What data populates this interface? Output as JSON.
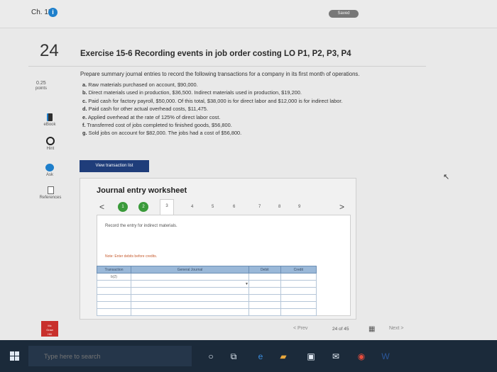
{
  "header": {
    "chapter": "Ch. 15",
    "saved_label": "Saved"
  },
  "question": {
    "number": "24",
    "title": "Exercise 15-6 Recording events in job order costing LO P1, P2, P3, P4",
    "points_value": "0.25",
    "points_label": "points",
    "prompt": "Prepare summary journal entries to record the following transactions for a company in its first month of operations.",
    "items": [
      {
        "letter": "a.",
        "text": "Raw materials purchased on account, $90,000."
      },
      {
        "letter": "b.",
        "text": "Direct materials used in production, $36,500. Indirect materials used in production, $19,200."
      },
      {
        "letter": "c.",
        "text": "Paid cash for factory payroll, $50,000. Of this total, $38,000 is for direct labor and $12,000 is for indirect labor."
      },
      {
        "letter": "d.",
        "text": "Paid cash for other actual overhead costs, $11,475."
      },
      {
        "letter": "e.",
        "text": "Applied overhead at the rate of 125% of direct labor cost."
      },
      {
        "letter": "f.",
        "text": "Transferred cost of jobs completed to finished goods, $56,800."
      },
      {
        "letter": "g.",
        "text": "Sold jobs on account for $82,000. The jobs had a cost of $56,800."
      }
    ]
  },
  "rail": {
    "ebook": "eBook",
    "hint": "Hint",
    "ask": "Ask",
    "references": "References"
  },
  "view_button": "View transaction list",
  "worksheet": {
    "title": "Journal entry worksheet",
    "prev": "<",
    "next": ">",
    "steps": [
      "1",
      "2",
      "3",
      "4",
      "5",
      "6",
      "7",
      "8",
      "9"
    ],
    "instruction": "Record the entry for indirect materials.",
    "note": "Note: Enter debits before credits.",
    "columns": [
      "Transaction",
      "General Journal",
      "Debit",
      "Credit"
    ],
    "first_transaction": "b(2)"
  },
  "footer": {
    "prev": "< Prev",
    "page": "24 of 45",
    "next": "Next >"
  },
  "taskbar": {
    "search_placeholder": "Type here to search"
  },
  "colors": {
    "accent": "#1e7fcb",
    "button": "#1f3d7a",
    "table_header": "#9ab8d8",
    "step_done": "#3a9a3a"
  }
}
